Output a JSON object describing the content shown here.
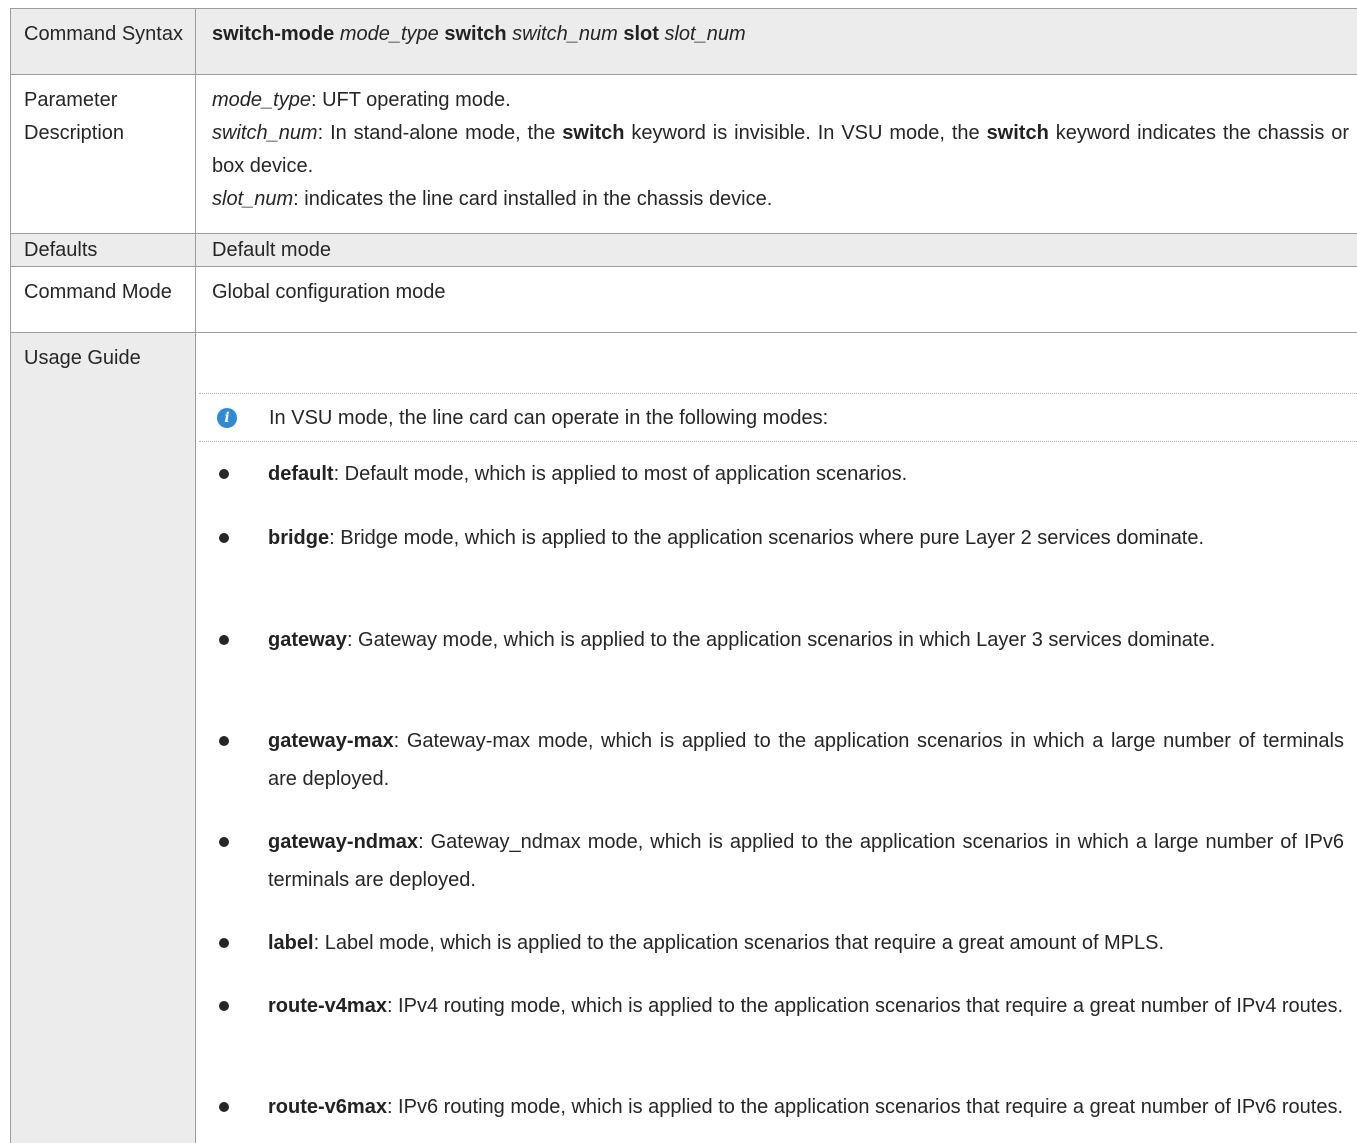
{
  "rows": {
    "syntax": {
      "label": "Command Syntax",
      "kw1": "switch-mode",
      "arg1": "mode_type",
      "kw2": "switch",
      "arg2": "switch_num",
      "kw3": "slot",
      "arg3": "slot_num"
    },
    "param": {
      "label": "Parameter Description",
      "p1_name": "mode_type",
      "p1_text": ": UFT operating mode.",
      "p2_name": "switch_num",
      "p2_a": ": In stand-alone mode, the ",
      "p2_kw1": "switch",
      "p2_b": " keyword is invisible. In VSU mode, the ",
      "p2_kw2": "switch",
      "p2_c": " keyword indicates the chassis or box device.",
      "p3_name": "slot_num",
      "p3_text": ": indicates the line card installed in the chassis device."
    },
    "defaults": {
      "label": "Defaults",
      "value": "Default mode"
    },
    "cmd_mode": {
      "label": "Command Mode",
      "value": "Global configuration mode"
    },
    "usage": {
      "label": "Usage Guide"
    }
  },
  "note": {
    "icon": "info-icon",
    "text": "In VSU mode, the line card can operate in the following modes:"
  },
  "modes": [
    {
      "name": "default",
      "desc": ": Default mode, which is applied to most of application scenarios."
    },
    {
      "name": "bridge",
      "desc": ": Bridge mode, which is applied to the application scenarios where pure Layer 2 services dominate."
    },
    {
      "name": "gateway",
      "desc": ": Gateway mode, which is applied to the application scenarios in which Layer 3 services dominate."
    },
    {
      "name": "gateway-max",
      "desc": ": Gateway-max mode, which is applied to the application scenarios in which a large number of terminals are deployed."
    },
    {
      "name": "gateway-ndmax",
      "desc": ": Gateway_ndmax mode, which is applied to the application scenarios in which a large number of IPv6 terminals are deployed."
    },
    {
      "name": "label",
      "desc": ": Label mode, which is applied to the application scenarios that require a great amount of MPLS."
    },
    {
      "name": "route-v4max",
      "desc": ": IPv4 routing mode, which is applied to the application scenarios that require a great number of IPv4 routes."
    },
    {
      "name": "route-v6max",
      "desc": ": IPv6 routing mode, which is applied to the application scenarios that require a great number of IPv6 routes."
    }
  ]
}
